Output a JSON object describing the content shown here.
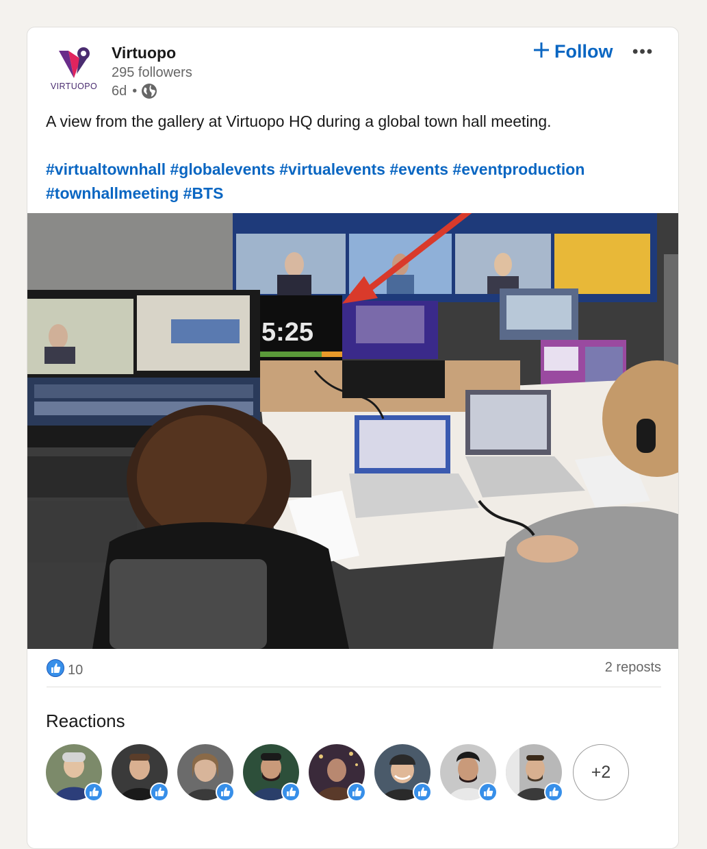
{
  "post": {
    "company": {
      "name": "Virtuopo",
      "logo_text": "VIRTUOPO",
      "followers": "295 followers",
      "time": "6d",
      "separator": "•"
    },
    "follow_label": "Follow",
    "more_label": "•••",
    "text": "A view from the gallery at Virtuopo HQ during a global town hall meeting.",
    "hashtags": [
      "#virtualtownhall",
      "#globalevents",
      "#virtualevents",
      "#events",
      "#eventproduction",
      "#townhallmeeting",
      "#BTS"
    ],
    "image": {
      "timer_text": "5:25"
    }
  },
  "social": {
    "likes_count": "10",
    "reposts": "2 reposts"
  },
  "reactions": {
    "title": "Reactions",
    "more_label": "+2",
    "avatars": [
      {
        "name": "reactor-1",
        "skin": "#e3c2a2",
        "bg": "#7c8a6a",
        "shirt": "#2c3e7a",
        "hair": "#d4d4d4"
      },
      {
        "name": "reactor-2",
        "skin": "#d9b091",
        "bg": "#3a3a3a",
        "shirt": "#1a1a1a",
        "hair": "#5a3d2a"
      },
      {
        "name": "reactor-3",
        "skin": "#d8b59a",
        "bg": "#6b6b6b",
        "shirt": "#3a3a3a",
        "hair": "#8a6a48"
      },
      {
        "name": "reactor-4",
        "skin": "#c99a7a",
        "bg": "#2d4f3a",
        "shirt": "#2a3f6a",
        "hair": "#1a1a1a"
      },
      {
        "name": "reactor-5",
        "skin": "#b88870",
        "bg": "#3a2a3a",
        "shirt": "#5a3a2a",
        "hair": "#2a1a1a"
      },
      {
        "name": "reactor-6",
        "skin": "#e0b898",
        "bg": "#4a5a6a",
        "shirt": "#2a2a2a",
        "hair": "#2a2a2a"
      },
      {
        "name": "reactor-7",
        "skin": "#c99a7a",
        "bg": "#c8c8c8",
        "shirt": "#e8e8e8",
        "hair": "#1a1a1a"
      },
      {
        "name": "reactor-8",
        "skin": "#d8b090",
        "bg": "#b8b8b8",
        "shirt": "#3a3a3a",
        "hair": "#3a2a1a"
      }
    ]
  },
  "colors": {
    "link_blue": "#0a66c2",
    "like_blue": "#378fe9",
    "arrow_red": "#d93a2b"
  }
}
